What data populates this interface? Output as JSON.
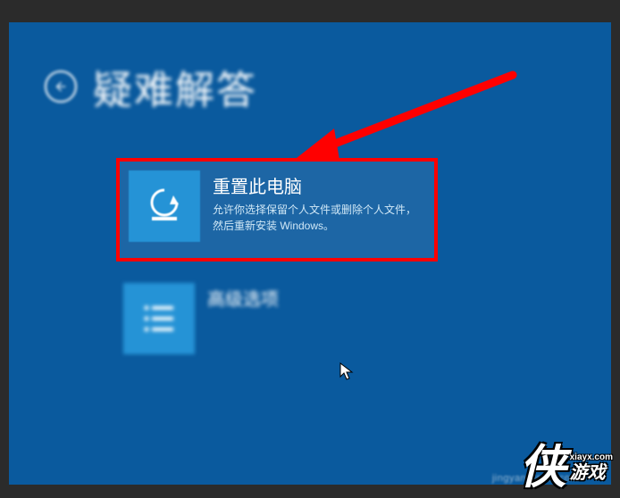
{
  "page": {
    "title": "疑难解答"
  },
  "tiles": {
    "reset": {
      "title": "重置此电脑",
      "desc": "允许你选择保留个人文件或删除个人文件，然后重新安装 Windows。"
    },
    "advanced": {
      "title": "高级选项"
    }
  },
  "watermark": {
    "line2": "jingyan.baidu.com"
  },
  "site_logo": {
    "main": "侠",
    "url": "xiayx.com",
    "sub": "游戏"
  }
}
